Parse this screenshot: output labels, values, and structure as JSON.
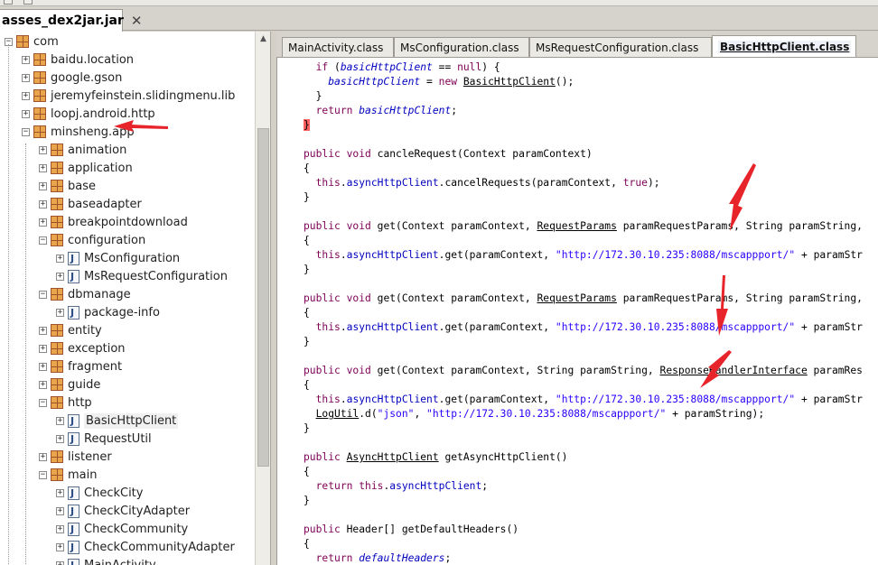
{
  "file_tab": {
    "label": "asses_dex2jar.jar",
    "close": "✕"
  },
  "tree": [
    {
      "label": "com",
      "depth": 0,
      "kind": "pkg",
      "exp": "−"
    },
    {
      "label": "baidu.location",
      "depth": 1,
      "kind": "pkg",
      "exp": "+"
    },
    {
      "label": "google.gson",
      "depth": 1,
      "kind": "pkg",
      "exp": "+"
    },
    {
      "label": "jeremyfeinstein.slidingmenu.lib",
      "depth": 1,
      "kind": "pkg",
      "exp": "+"
    },
    {
      "label": "loopj.android.http",
      "depth": 1,
      "kind": "pkg",
      "exp": "+"
    },
    {
      "label": "minsheng.app",
      "depth": 1,
      "kind": "pkg",
      "exp": "−"
    },
    {
      "label": "animation",
      "depth": 2,
      "kind": "pkg",
      "exp": "+"
    },
    {
      "label": "application",
      "depth": 2,
      "kind": "pkg",
      "exp": "+"
    },
    {
      "label": "base",
      "depth": 2,
      "kind": "pkg",
      "exp": "+"
    },
    {
      "label": "baseadapter",
      "depth": 2,
      "kind": "pkg",
      "exp": "+"
    },
    {
      "label": "breakpointdownload",
      "depth": 2,
      "kind": "pkg",
      "exp": "+"
    },
    {
      "label": "configuration",
      "depth": 2,
      "kind": "pkg",
      "exp": "−"
    },
    {
      "label": "MsConfiguration",
      "depth": 3,
      "kind": "java",
      "exp": "+"
    },
    {
      "label": "MsRequestConfiguration",
      "depth": 3,
      "kind": "java",
      "exp": "+"
    },
    {
      "label": "dbmanage",
      "depth": 2,
      "kind": "pkg",
      "exp": "−"
    },
    {
      "label": "package-info",
      "depth": 3,
      "kind": "java",
      "exp": "+"
    },
    {
      "label": "entity",
      "depth": 2,
      "kind": "pkg",
      "exp": "+"
    },
    {
      "label": "exception",
      "depth": 2,
      "kind": "pkg",
      "exp": "+"
    },
    {
      "label": "fragment",
      "depth": 2,
      "kind": "pkg",
      "exp": "+"
    },
    {
      "label": "guide",
      "depth": 2,
      "kind": "pkg",
      "exp": "+"
    },
    {
      "label": "http",
      "depth": 2,
      "kind": "pkg",
      "exp": "−"
    },
    {
      "label": "BasicHttpClient",
      "depth": 3,
      "kind": "java",
      "exp": "+",
      "selected": true
    },
    {
      "label": "RequestUtil",
      "depth": 3,
      "kind": "java",
      "exp": "+"
    },
    {
      "label": "listener",
      "depth": 2,
      "kind": "pkg",
      "exp": "+"
    },
    {
      "label": "main",
      "depth": 2,
      "kind": "pkg",
      "exp": "−"
    },
    {
      "label": "CheckCity",
      "depth": 3,
      "kind": "java",
      "exp": "+"
    },
    {
      "label": "CheckCityAdapter",
      "depth": 3,
      "kind": "java",
      "exp": "+"
    },
    {
      "label": "CheckCommunity",
      "depth": 3,
      "kind": "java",
      "exp": "+"
    },
    {
      "label": "CheckCommunityAdapter",
      "depth": 3,
      "kind": "java",
      "exp": "+"
    },
    {
      "label": "MainActivity",
      "depth": 3,
      "kind": "java",
      "exp": "+"
    }
  ],
  "code_tabs": [
    {
      "label": "MainActivity.class",
      "active": false
    },
    {
      "label": "MsConfiguration.class",
      "active": false
    },
    {
      "label": "MsRequestConfiguration.class",
      "active": false
    },
    {
      "label": "BasicHttpClient.class",
      "active": true,
      "close": "✕"
    }
  ],
  "code_lines": [
    [
      [
        "  ",
        ""
      ],
      [
        "if",
        "kw"
      ],
      [
        " (",
        ""
      ],
      [
        "basicHttpClient",
        "fld it"
      ],
      [
        " == ",
        ""
      ],
      [
        "null",
        "kw"
      ],
      [
        ") {",
        ""
      ]
    ],
    [
      [
        "    ",
        ""
      ],
      [
        "basicHttpClient",
        "fld it"
      ],
      [
        " = ",
        ""
      ],
      [
        "new",
        "kw"
      ],
      [
        " ",
        ""
      ],
      [
        "BasicHttpClient",
        "ul"
      ],
      [
        "();",
        ""
      ]
    ],
    [
      [
        "  }",
        ""
      ]
    ],
    [
      [
        "  ",
        ""
      ],
      [
        "return",
        "kw"
      ],
      [
        " ",
        ""
      ],
      [
        "basicHttpClient",
        "fld it"
      ],
      [
        ";",
        ""
      ]
    ],
    [
      [
        "}",
        "brace-red"
      ]
    ],
    [
      [
        "",
        ""
      ]
    ],
    [
      [
        "public",
        "kw"
      ],
      [
        " ",
        ""
      ],
      [
        "void",
        "kw"
      ],
      [
        " cancleRequest(Context paramContext)",
        ""
      ]
    ],
    [
      [
        "{",
        ""
      ]
    ],
    [
      [
        "  ",
        ""
      ],
      [
        "this",
        "kw"
      ],
      [
        ".",
        ""
      ],
      [
        "asyncHttpClient",
        "fld"
      ],
      [
        ".cancelRequests(paramContext, ",
        ""
      ],
      [
        "true",
        "kw"
      ],
      [
        ");",
        ""
      ]
    ],
    [
      [
        "}",
        ""
      ]
    ],
    [
      [
        "",
        ""
      ]
    ],
    [
      [
        "public",
        "kw"
      ],
      [
        " ",
        ""
      ],
      [
        "void",
        "kw"
      ],
      [
        " get(Context paramContext, ",
        ""
      ],
      [
        "RequestParams",
        "ul"
      ],
      [
        " paramRequestParams, String paramString, ",
        ""
      ]
    ],
    [
      [
        "{",
        ""
      ]
    ],
    [
      [
        "  ",
        ""
      ],
      [
        "this",
        "kw"
      ],
      [
        ".",
        ""
      ],
      [
        "asyncHttpClient",
        "fld"
      ],
      [
        ".get(paramContext, ",
        ""
      ],
      [
        "\"http://172.30.10.235:8088/mscappport/\"",
        "str"
      ],
      [
        " + paramStr",
        ""
      ]
    ],
    [
      [
        "}",
        ""
      ]
    ],
    [
      [
        "",
        ""
      ]
    ],
    [
      [
        "public",
        "kw"
      ],
      [
        " ",
        ""
      ],
      [
        "void",
        "kw"
      ],
      [
        " get(Context paramContext, ",
        ""
      ],
      [
        "RequestParams",
        "ul"
      ],
      [
        " paramRequestParams, String paramString, ",
        ""
      ]
    ],
    [
      [
        "{",
        ""
      ]
    ],
    [
      [
        "  ",
        ""
      ],
      [
        "this",
        "kw"
      ],
      [
        ".",
        ""
      ],
      [
        "asyncHttpClient",
        "fld"
      ],
      [
        ".get(paramContext, ",
        ""
      ],
      [
        "\"http://172.30.10.235:8088/mscappport/\"",
        "str"
      ],
      [
        " + paramStr",
        ""
      ]
    ],
    [
      [
        "}",
        ""
      ]
    ],
    [
      [
        "",
        ""
      ]
    ],
    [
      [
        "public",
        "kw"
      ],
      [
        " ",
        ""
      ],
      [
        "void",
        "kw"
      ],
      [
        " get(Context paramContext, String paramString, ",
        ""
      ],
      [
        "ResponseHandlerInterface",
        "ul"
      ],
      [
        " paramRes",
        ""
      ]
    ],
    [
      [
        "{",
        ""
      ]
    ],
    [
      [
        "  ",
        ""
      ],
      [
        "this",
        "kw"
      ],
      [
        ".",
        ""
      ],
      [
        "asyncHttpClient",
        "fld"
      ],
      [
        ".get(paramContext, ",
        ""
      ],
      [
        "\"http://172.30.10.235:8088/mscappport/\"",
        "str"
      ],
      [
        " + paramStr",
        ""
      ]
    ],
    [
      [
        "  ",
        ""
      ],
      [
        "LogUtil",
        "ul"
      ],
      [
        ".d(",
        ""
      ],
      [
        "\"json\"",
        "str"
      ],
      [
        ", ",
        ""
      ],
      [
        "\"http://172.30.10.235:8088/mscappport/\"",
        "str"
      ],
      [
        " + paramString);",
        ""
      ]
    ],
    [
      [
        "}",
        ""
      ]
    ],
    [
      [
        "",
        ""
      ]
    ],
    [
      [
        "public",
        "kw"
      ],
      [
        " ",
        ""
      ],
      [
        "AsyncHttpClient",
        "ul"
      ],
      [
        " getAsyncHttpClient()",
        ""
      ]
    ],
    [
      [
        "{",
        ""
      ]
    ],
    [
      [
        "  ",
        ""
      ],
      [
        "return",
        "kw"
      ],
      [
        " ",
        ""
      ],
      [
        "this",
        "kw"
      ],
      [
        ".",
        ""
      ],
      [
        "asyncHttpClient",
        "fld"
      ],
      [
        ";",
        ""
      ]
    ],
    [
      [
        "}",
        ""
      ]
    ],
    [
      [
        "",
        ""
      ]
    ],
    [
      [
        "public",
        "kw"
      ],
      [
        " Header[] getDefaultHeaders()",
        ""
      ]
    ],
    [
      [
        "{",
        ""
      ]
    ],
    [
      [
        "  ",
        ""
      ],
      [
        "return",
        "kw"
      ],
      [
        " ",
        ""
      ],
      [
        "defaultHeaders",
        "fld it"
      ],
      [
        ";",
        ""
      ]
    ]
  ],
  "colors": {
    "arrow": "#e8242b",
    "keyword": "#7f0055",
    "field": "#0000c0",
    "string": "#2a00ff"
  }
}
